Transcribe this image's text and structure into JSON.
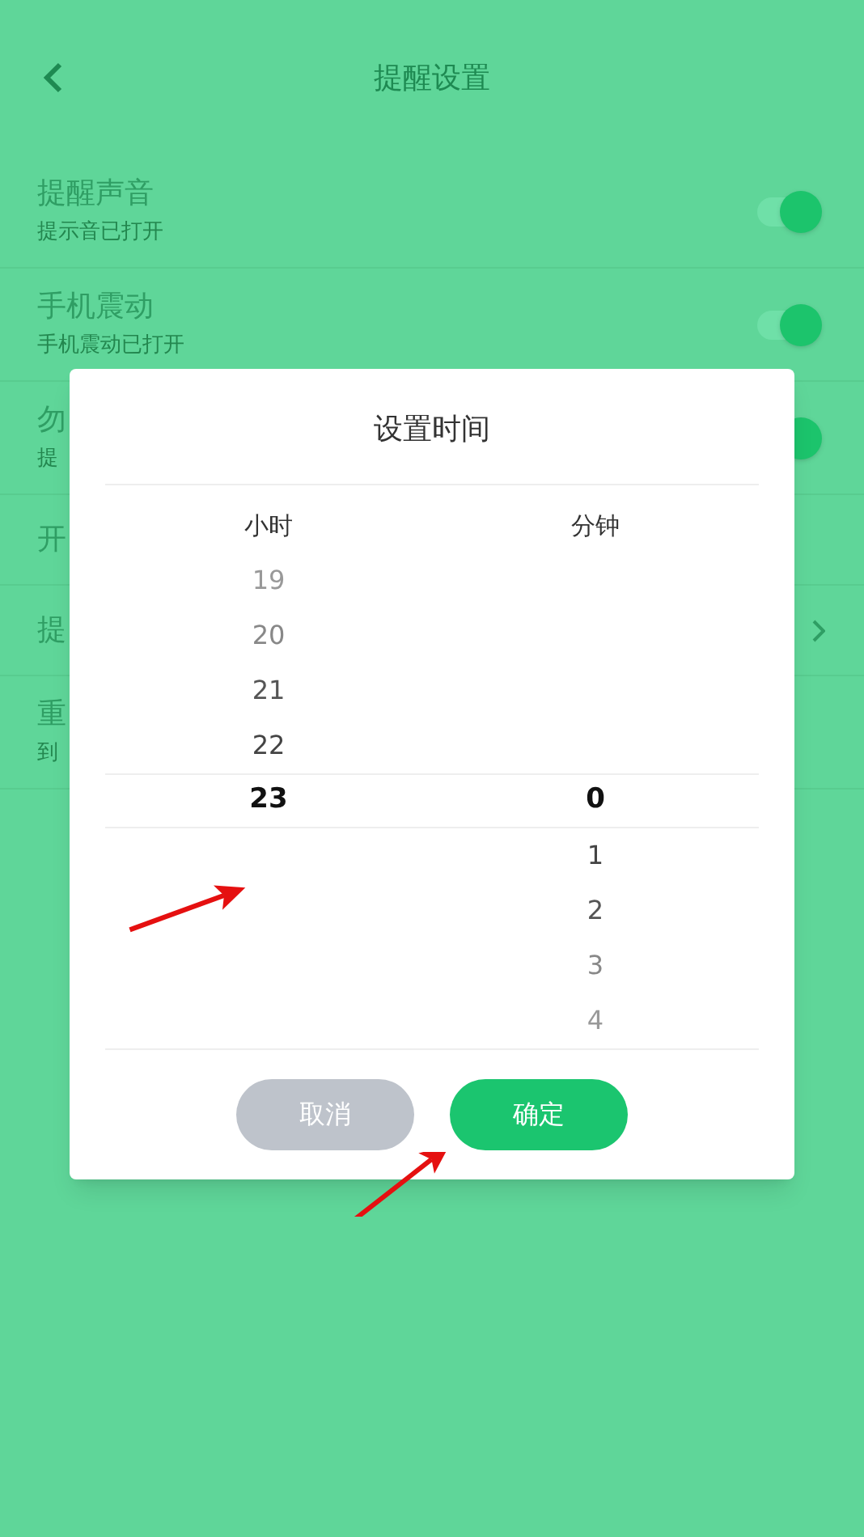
{
  "header": {
    "title": "提醒设置"
  },
  "settings": [
    {
      "kind": "toggle",
      "title": "提醒声音",
      "subtitle": "提示音已打开",
      "on": true
    },
    {
      "kind": "toggle",
      "title": "手机震动",
      "subtitle": "手机震动已打开",
      "on": true
    },
    {
      "kind": "toggle",
      "title": "勿",
      "subtitle": "提",
      "on": true
    },
    {
      "kind": "plain",
      "title": "开"
    },
    {
      "kind": "link",
      "title": "提"
    },
    {
      "kind": "plain",
      "title": "重",
      "subtitle": "到"
    }
  ],
  "dialog": {
    "title": "设置时间",
    "columns": [
      {
        "label": "小时",
        "items": [
          {
            "value": "19",
            "selected": false
          },
          {
            "value": "20",
            "selected": false
          },
          {
            "value": "21",
            "selected": false
          },
          {
            "value": "22",
            "selected": false
          },
          {
            "value": "23",
            "selected": true
          }
        ]
      },
      {
        "label": "分钟",
        "items": [
          {
            "value": "0",
            "selected": true
          },
          {
            "value": "1",
            "selected": false
          },
          {
            "value": "2",
            "selected": false
          },
          {
            "value": "3",
            "selected": false
          },
          {
            "value": "4",
            "selected": false
          }
        ]
      }
    ],
    "buttons": [
      {
        "kind": "cancel",
        "label": "取消"
      },
      {
        "kind": "confirm",
        "label": "确定"
      }
    ]
  }
}
